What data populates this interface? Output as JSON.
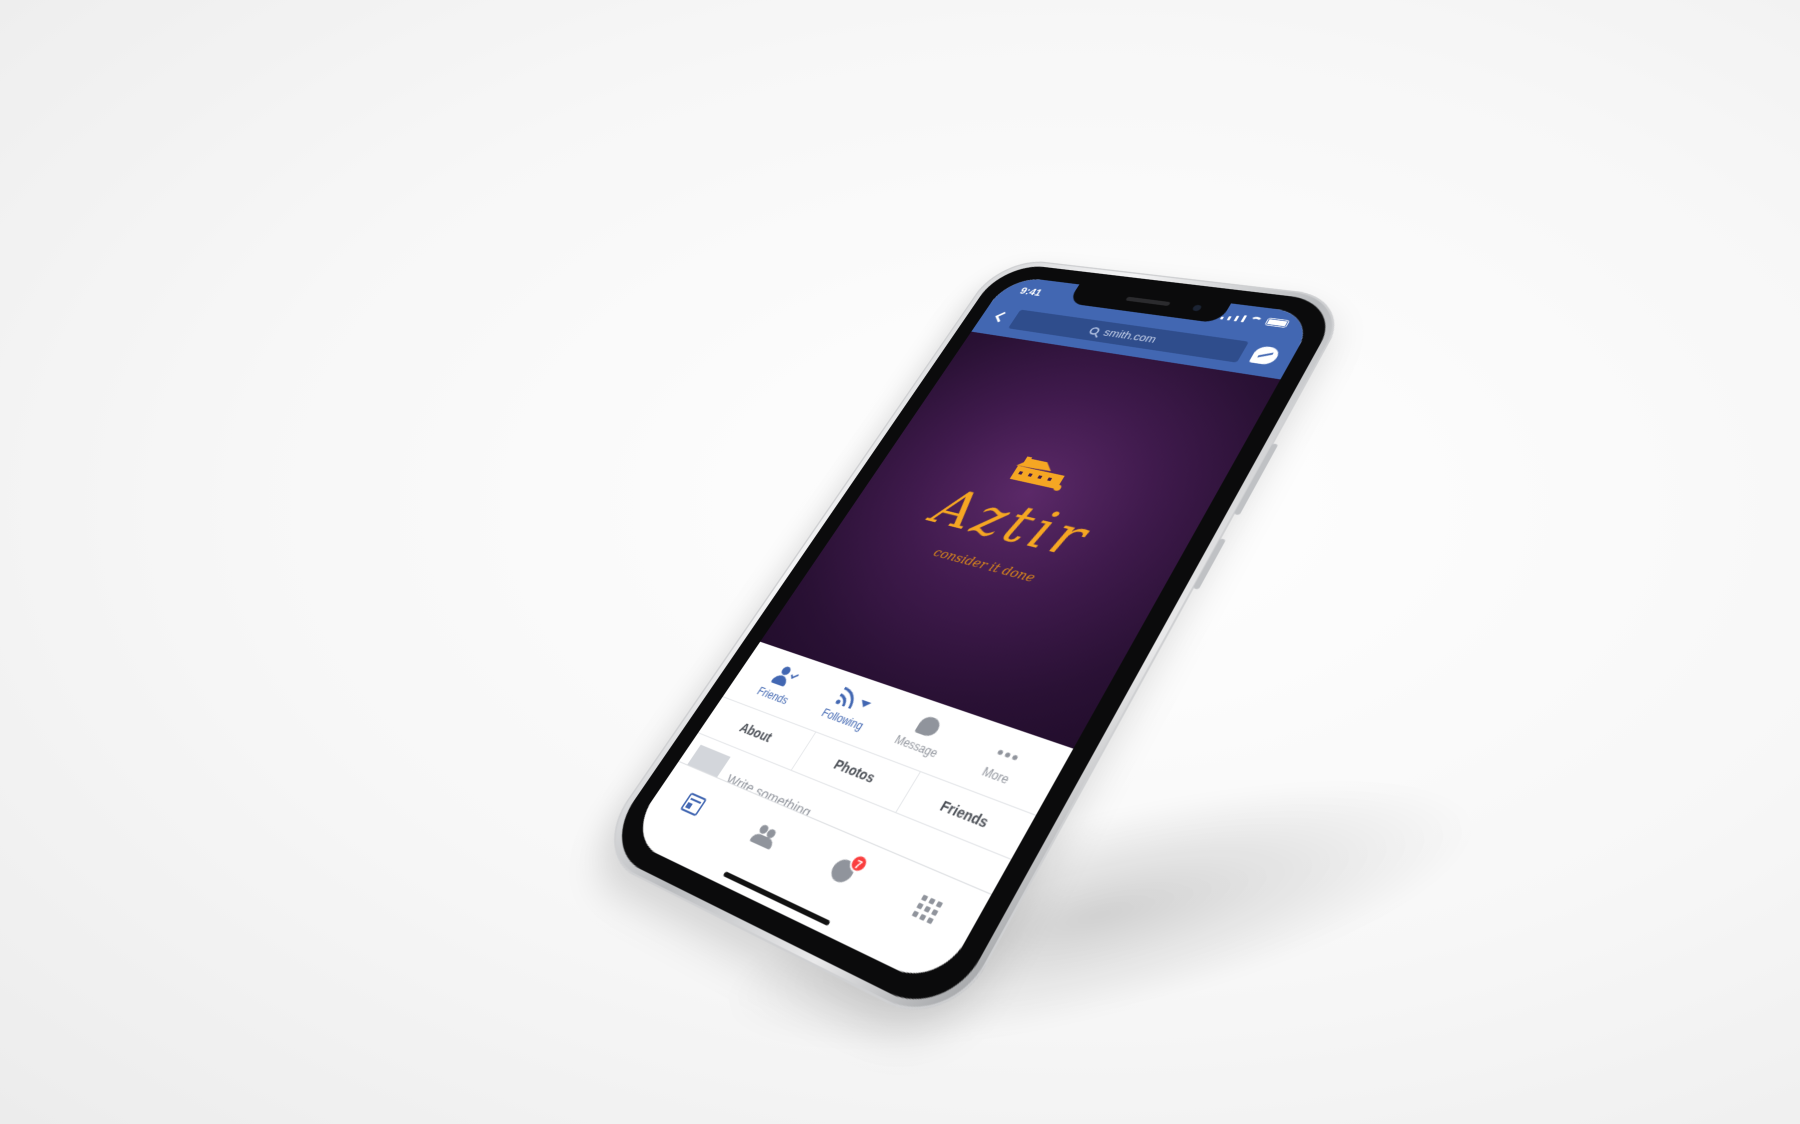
{
  "status_bar": {
    "time": "9:41"
  },
  "nav": {
    "search_text": "smith.com"
  },
  "cover": {
    "brand_name": "Aztir",
    "tagline": "consider it done",
    "background_color": "#3f1a4c",
    "accent_color": "#f5a623",
    "logo_icon": "house-logo-icon"
  },
  "actions": {
    "friends": {
      "label": "Friends",
      "icon": "friends-check-icon"
    },
    "following": {
      "label": "Following",
      "icon": "rss-follow-icon"
    },
    "message": {
      "label": "Message",
      "icon": "messenger-icon"
    },
    "more": {
      "label": "More",
      "icon": "more-dots-icon"
    }
  },
  "tabs": [
    {
      "label": "About"
    },
    {
      "label": "Photos"
    },
    {
      "label": "Friends"
    }
  ],
  "composer": {
    "placeholder": "Write something..."
  },
  "bottom_nav": {
    "items": [
      {
        "icon": "news-feed-icon",
        "active": true
      },
      {
        "icon": "friend-requests-icon",
        "active": false
      },
      {
        "icon": "notifications-globe-icon",
        "active": false,
        "badge": "7"
      },
      {
        "icon": "menu-grid-icon",
        "active": false
      }
    ]
  },
  "theme": {
    "brand_blue": "#4267b2",
    "badge_red": "#fa3e3e"
  }
}
